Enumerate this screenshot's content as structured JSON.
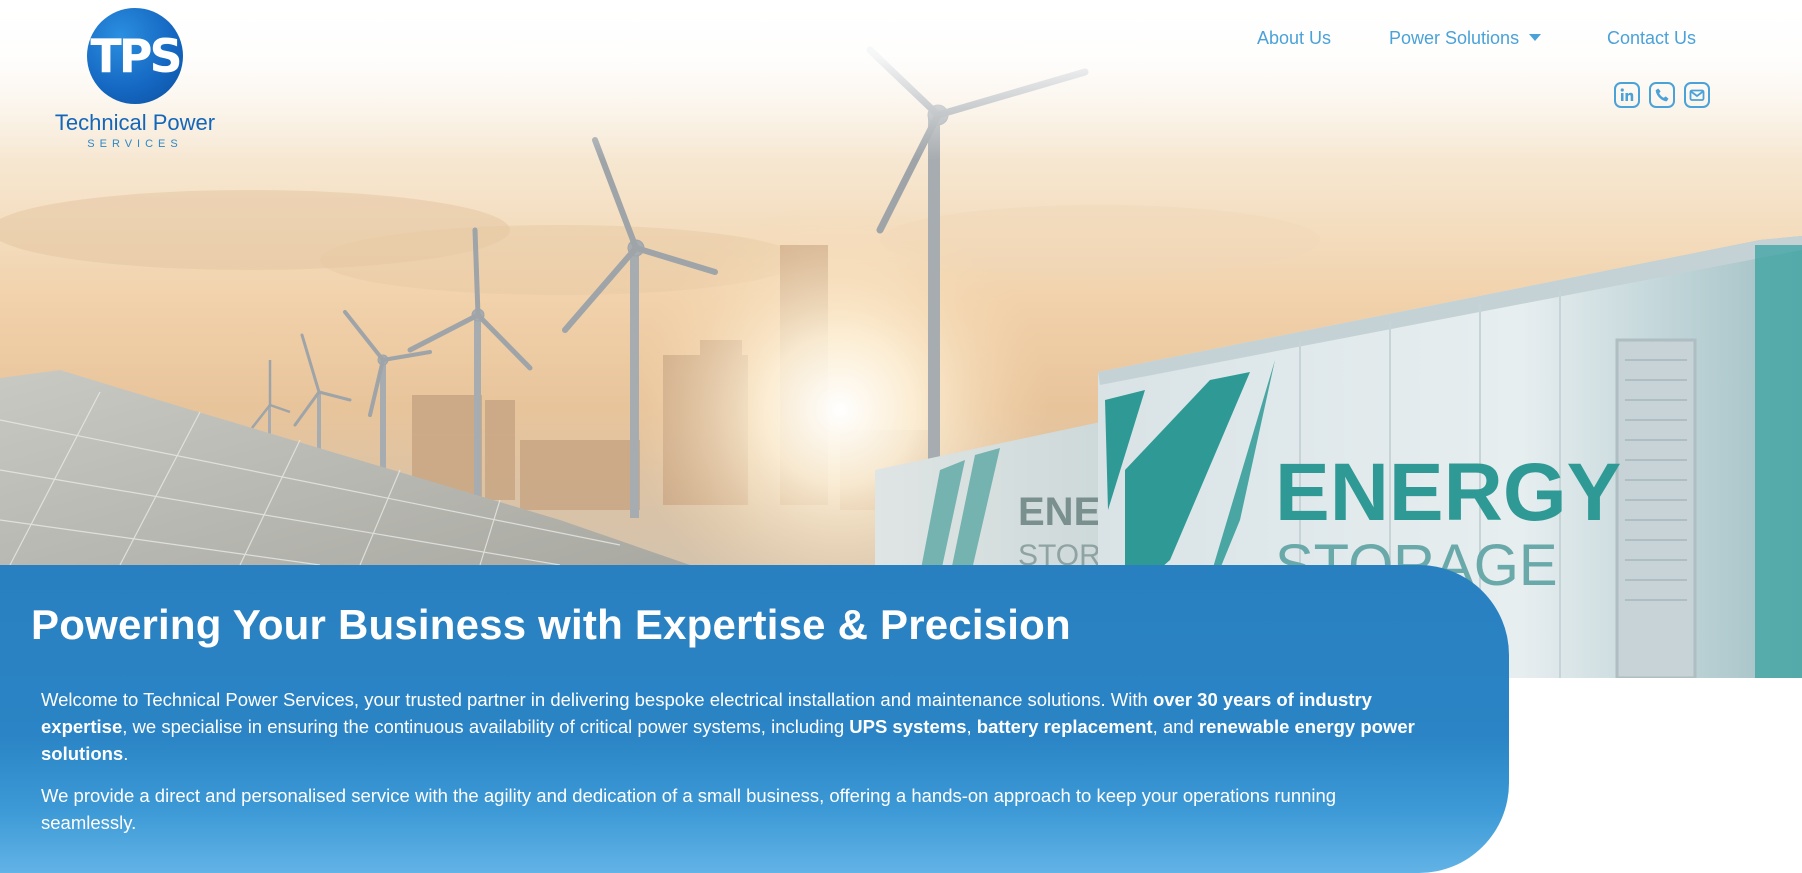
{
  "brand": {
    "logo_text": "TPS",
    "name": "Technical Power",
    "subtitle": "SERVICES"
  },
  "nav": {
    "items": [
      {
        "label": "About Us"
      },
      {
        "label": "Power Solutions",
        "has_dropdown": true
      },
      {
        "label": "Contact Us"
      }
    ]
  },
  "social": {
    "icons": [
      "linkedin-icon",
      "phone-icon",
      "email-icon"
    ]
  },
  "hero_image": {
    "container_text_large": "ENERGY",
    "container_text_large_sub": "STORAGE",
    "container_text_small": "ENERGY",
    "container_text_small_sub": "STORAGE"
  },
  "intro": {
    "heading": "Powering Your Business with Expertise & Precision",
    "p1": {
      "t1": "Welcome to Technical Power Services, your trusted partner in delivering bespoke electrical installation and maintenance solutions. With ",
      "b1": "over 30 years of industry expertise",
      "t2": ", we specialise in ensuring the continuous availability of critical power systems, including ",
      "b2": "UPS systems",
      "t3": ", ",
      "b3": "battery replacement",
      "t4": ", and ",
      "b4": "renewable energy power solutions",
      "t5": "."
    },
    "p2": "We provide a direct and personalised service with the agility and dedication of a small business, offering a hands-on approach to keep your operations running seamlessly."
  },
  "colors": {
    "brand_blue": "#1466b8",
    "nav_link": "#4aa2d8",
    "card_blue": "#2980c0"
  }
}
